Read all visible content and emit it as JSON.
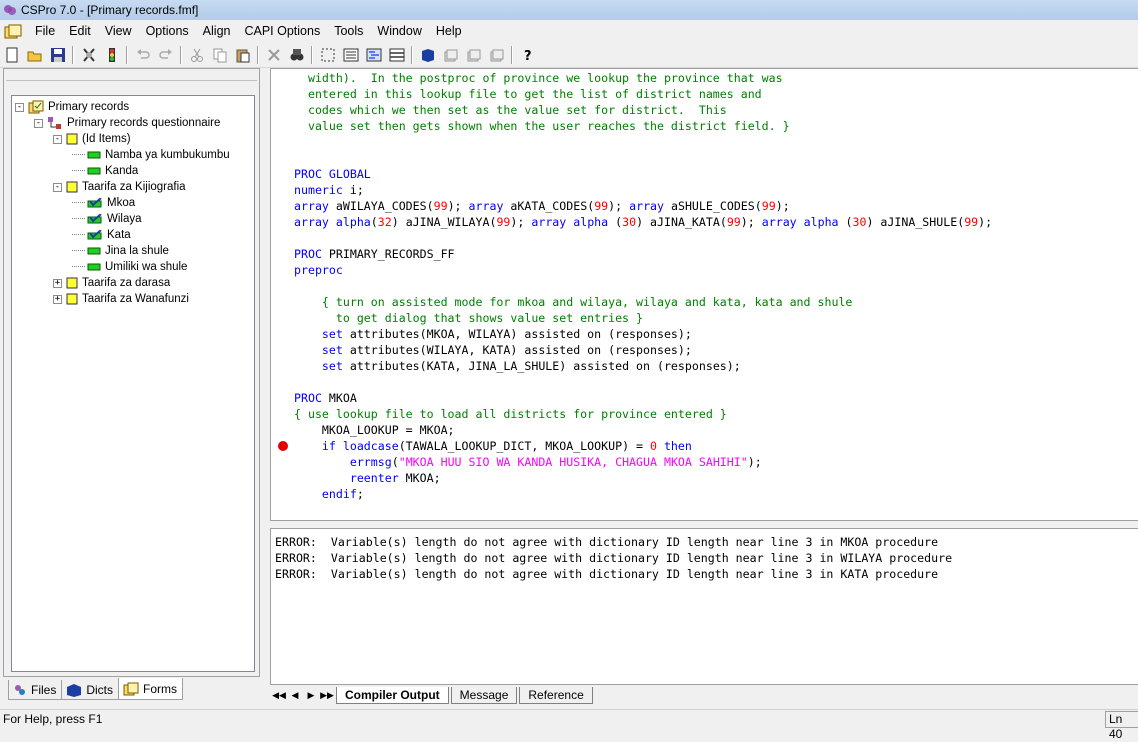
{
  "window": {
    "title": "CSPro 7.0 - [Primary records.fmf]"
  },
  "menu": [
    "File",
    "Edit",
    "View",
    "Options",
    "Align",
    "CAPI Options",
    "Tools",
    "Window",
    "Help"
  ],
  "toolbar": {
    "buttons": [
      "new-icon",
      "open-icon",
      "save-icon",
      "generate-icon",
      "run-icon",
      "undo-icon",
      "redo-icon",
      "cut-icon",
      "copy-icon",
      "paste-icon",
      "delete-icon",
      "find-icon",
      "select-icon",
      "view-form-icon",
      "view-logic-icon",
      "view-list-icon",
      "book-icon",
      "stack1-icon",
      "stack2-icon",
      "stack3-icon",
      "help-icon"
    ]
  },
  "tree": [
    {
      "label": "Primary records",
      "expander": "-",
      "icon": "form-file"
    },
    {
      "label": "Primary records questionnaire",
      "expander": "-",
      "icon": "questionnaire"
    },
    {
      "label": "(Id Items)",
      "expander": "-",
      "icon": "yellow-box"
    },
    {
      "label": "Namba ya kumbukumbu",
      "expander": "",
      "icon": "green-bar"
    },
    {
      "label": "Kanda",
      "expander": "",
      "icon": "green-bar"
    },
    {
      "label": "Taarifa za Kijiografia",
      "expander": "-",
      "icon": "yellow-box"
    },
    {
      "label": "Mkoa",
      "expander": "",
      "icon": "check-bar"
    },
    {
      "label": "Wilaya",
      "expander": "",
      "icon": "check-bar"
    },
    {
      "label": "Kata",
      "expander": "",
      "icon": "check-bar"
    },
    {
      "label": "Jina la shule",
      "expander": "",
      "icon": "green-bar"
    },
    {
      "label": "Umiliki wa shule",
      "expander": "",
      "icon": "green-bar"
    },
    {
      "label": "Taarifa za darasa",
      "expander": "+",
      "icon": "yellow-box"
    },
    {
      "label": "Taarifa za Wanafunzi",
      "expander": "+",
      "icon": "yellow-box"
    }
  ],
  "left_tabs": [
    "Files",
    "Dicts",
    "Forms"
  ],
  "colors": {
    "keyword": "#0000ff",
    "comment": "#008000",
    "number": "#ff0000",
    "string": "#ff00ff",
    "text": "#000000",
    "breakpoint": "#e00000"
  },
  "code": [
    [
      {
        "t": "  width).  In the postproc of province we lookup the province that was",
        "c": "comment"
      }
    ],
    [
      {
        "t": "  entered in this lookup file to get the list of district names and",
        "c": "comment"
      }
    ],
    [
      {
        "t": "  codes which we then set as the value set for district.  This",
        "c": "comment"
      }
    ],
    [
      {
        "t": "  value set then gets shown when the user reaches the district field. }",
        "c": "comment"
      }
    ],
    [],
    [],
    [
      {
        "t": "PROC GLOBAL",
        "c": "keyword"
      }
    ],
    [
      {
        "t": "numeric",
        "c": "keyword"
      },
      {
        "t": " i;",
        "c": "text"
      }
    ],
    [
      {
        "t": "array",
        "c": "keyword"
      },
      {
        "t": " aWILAYA_CODES(",
        "c": "text"
      },
      {
        "t": "99",
        "c": "number"
      },
      {
        "t": "); ",
        "c": "text"
      },
      {
        "t": "array",
        "c": "keyword"
      },
      {
        "t": " aKATA_CODES(",
        "c": "text"
      },
      {
        "t": "99",
        "c": "number"
      },
      {
        "t": "); ",
        "c": "text"
      },
      {
        "t": "array",
        "c": "keyword"
      },
      {
        "t": " aSHULE_CODES(",
        "c": "text"
      },
      {
        "t": "99",
        "c": "number"
      },
      {
        "t": ");",
        "c": "text"
      }
    ],
    [
      {
        "t": "array alpha",
        "c": "keyword"
      },
      {
        "t": "(",
        "c": "text"
      },
      {
        "t": "32",
        "c": "number"
      },
      {
        "t": ") aJINA_WILAYA(",
        "c": "text"
      },
      {
        "t": "99",
        "c": "number"
      },
      {
        "t": "); ",
        "c": "text"
      },
      {
        "t": "array alpha",
        "c": "keyword"
      },
      {
        "t": " (",
        "c": "text"
      },
      {
        "t": "30",
        "c": "number"
      },
      {
        "t": ") aJINA_KATA(",
        "c": "text"
      },
      {
        "t": "99",
        "c": "number"
      },
      {
        "t": "); ",
        "c": "text"
      },
      {
        "t": "array alpha",
        "c": "keyword"
      },
      {
        "t": " (",
        "c": "text"
      },
      {
        "t": "30",
        "c": "number"
      },
      {
        "t": ") aJINA_SHULE(",
        "c": "text"
      },
      {
        "t": "99",
        "c": "number"
      },
      {
        "t": ");",
        "c": "text"
      }
    ],
    [],
    [
      {
        "t": "PROC",
        "c": "keyword"
      },
      {
        "t": " PRIMARY_RECORDS_FF",
        "c": "text"
      }
    ],
    [
      {
        "t": "preproc",
        "c": "keyword"
      }
    ],
    [],
    [
      {
        "t": "    { turn on assisted mode for mkoa and wilaya, wilaya and kata, kata and shule",
        "c": "comment"
      }
    ],
    [
      {
        "t": "      to get dialog that shows value set entries }",
        "c": "comment"
      }
    ],
    [
      {
        "t": "    set",
        "c": "keyword"
      },
      {
        "t": " attributes(MKOA, WILAYA) assisted on (responses);",
        "c": "text"
      }
    ],
    [
      {
        "t": "    set",
        "c": "keyword"
      },
      {
        "t": " attributes(WILAYA, KATA) assisted on (responses);",
        "c": "text"
      }
    ],
    [
      {
        "t": "    set",
        "c": "keyword"
      },
      {
        "t": " attributes(KATA, JINA_LA_SHULE) assisted on (responses);",
        "c": "text"
      }
    ],
    [],
    [
      {
        "t": "PROC",
        "c": "keyword"
      },
      {
        "t": " MKOA",
        "c": "text"
      }
    ],
    [
      {
        "t": "{ use lookup file to load all districts for province entered }",
        "c": "comment"
      }
    ],
    [
      {
        "t": "    MKOA_LOOKUP = MKOA;",
        "c": "text"
      }
    ],
    [
      {
        "t": "    if loadcase",
        "c": "keyword"
      },
      {
        "t": "(TAWALA_LOOKUP_DICT, MKOA_LOOKUP) = ",
        "c": "text"
      },
      {
        "t": "0",
        "c": "number"
      },
      {
        "t": " then",
        "c": "keyword"
      }
    ],
    [
      {
        "t": "        errmsg",
        "c": "keyword"
      },
      {
        "t": "(",
        "c": "text"
      },
      {
        "t": "\"MKOA HUU SIO WA KANDA HUSIKA, CHAGUA MKOA SAHIHI\"",
        "c": "string"
      },
      {
        "t": ");",
        "c": "text"
      }
    ],
    [
      {
        "t": "        reenter",
        "c": "keyword"
      },
      {
        "t": " MKOA;",
        "c": "text"
      }
    ],
    [
      {
        "t": "    endif",
        "c": "keyword"
      },
      {
        "t": ";",
        "c": "text"
      }
    ]
  ],
  "breakpoint_line": 23,
  "output": [
    "ERROR:  Variable(s) length do not agree with dictionary ID length near line 3 in MKOA procedure",
    "ERROR:  Variable(s) length do not agree with dictionary ID length near line 3 in WILAYA procedure",
    "ERROR:  Variable(s) length do not agree with dictionary ID length near line 3 in KATA procedure"
  ],
  "output_tabs": [
    "Compiler Output",
    "Message",
    "Reference"
  ],
  "status": {
    "help": "For Help, press F1",
    "line": "Ln 40"
  }
}
